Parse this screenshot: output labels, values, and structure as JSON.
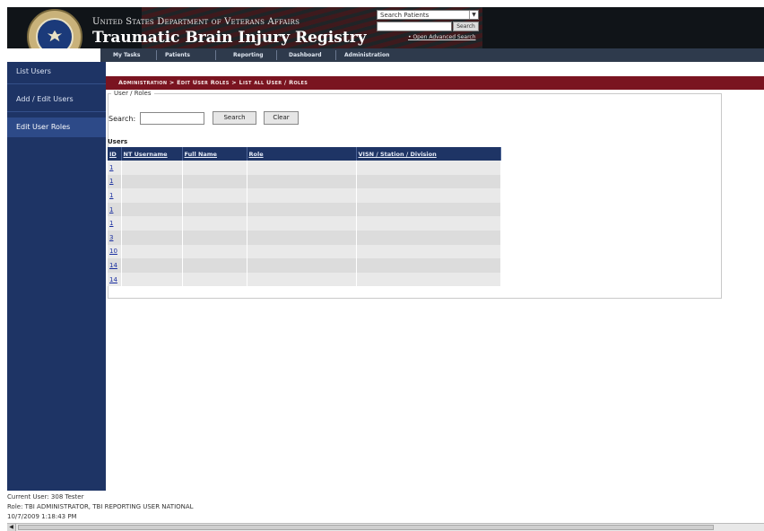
{
  "header": {
    "agency": "United States Department of Veterans Affairs",
    "title": "Traumatic Brain Injury Registry",
    "search_select": "Search Patients",
    "search_button": "Search",
    "advanced_link": "• Open Advanced Search"
  },
  "topnav": [
    "My Tasks",
    "Patients",
    "Reporting",
    "Dashboard",
    "Administration"
  ],
  "sidebar": {
    "items": [
      {
        "label": "List Users"
      },
      {
        "label": "Add / Edit Users"
      },
      {
        "label": "Edit User Roles"
      }
    ]
  },
  "breadcrumb": "Administration > Edit User Roles > List all User / Roles",
  "form": {
    "legend": "User / Roles",
    "search_label": "Search:",
    "search_value": "",
    "search_button": "Search",
    "clear_button": "Clear"
  },
  "users": {
    "label": "Users",
    "columns": [
      "ID",
      "NT Username",
      "Full Name",
      "Role",
      "VISN / Station / Division"
    ],
    "rows": [
      [
        "1",
        "",
        "",
        "",
        ""
      ],
      [
        "1",
        "",
        "",
        "",
        ""
      ],
      [
        "1",
        "",
        "",
        "",
        ""
      ],
      [
        "1",
        "",
        "",
        "",
        ""
      ],
      [
        "1",
        "",
        "",
        "",
        ""
      ],
      [
        "3",
        "",
        "",
        "",
        ""
      ],
      [
        "10",
        "",
        "",
        "",
        ""
      ],
      [
        "14",
        "",
        "",
        "",
        ""
      ],
      [
        "14",
        "",
        "",
        "",
        ""
      ]
    ]
  },
  "footer": {
    "current_user": "Current User:   308 Tester",
    "role": "Role: TBI ADMINISTRATOR, TBI REPORTING USER NATIONAL",
    "timestamp": "10/7/2009 1:18:43 PM"
  },
  "colors": {
    "sidebar": "#1e3465",
    "breadcrumb_bar": "#7a1420",
    "table_header": "#1e3465"
  }
}
